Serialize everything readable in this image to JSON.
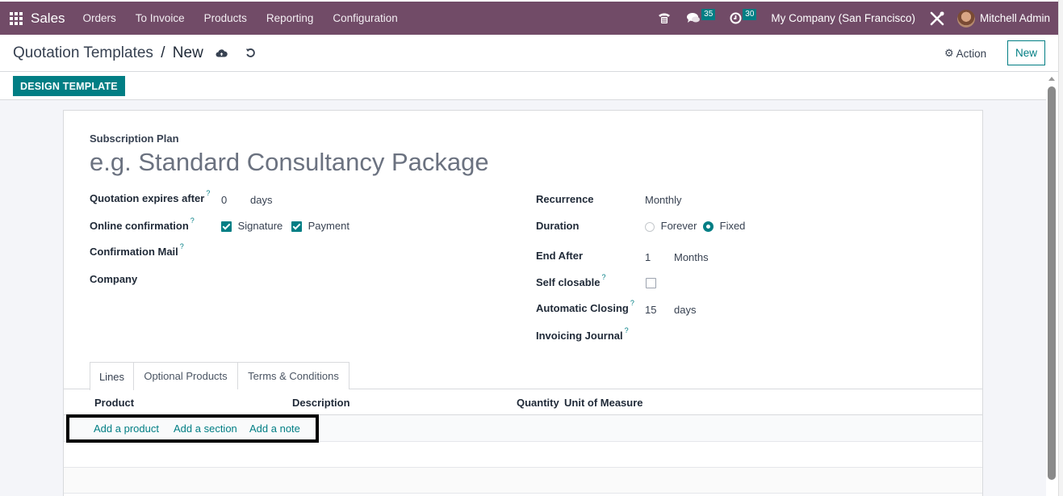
{
  "navbar": {
    "app_name": "Sales",
    "menu": [
      "Orders",
      "To Invoice",
      "Products",
      "Reporting",
      "Configuration"
    ],
    "icons": {
      "apps": "apps-grid-icon",
      "phone": "phone-icon",
      "messages": "chat-icon",
      "activities": "clock-icon",
      "debug": "tools-icon"
    },
    "messages_count": "35",
    "activities_count": "30",
    "company": "My Company (San Francisco)",
    "user": "Mitchell Admin"
  },
  "control_panel": {
    "breadcrumb_parent": "Quotation Templates",
    "breadcrumb_separator": "/",
    "breadcrumb_current": "New",
    "action_label": "Action",
    "new_label": "New"
  },
  "statusbar": {
    "design_template_label": "DESIGN TEMPLATE"
  },
  "form": {
    "plan_label": "Subscription Plan",
    "plan_name_placeholder": "e.g. Standard Consultancy Package",
    "left": {
      "quotation_expires_label": "Quotation expires after",
      "quotation_expires_value": "0",
      "quotation_expires_unit": "days",
      "online_confirmation_label": "Online confirmation",
      "signature_label": "Signature",
      "signature_checked": true,
      "payment_label": "Payment",
      "payment_checked": true,
      "confirmation_mail_label": "Confirmation Mail",
      "company_label": "Company"
    },
    "right": {
      "recurrence_label": "Recurrence",
      "recurrence_value": "Monthly",
      "duration_label": "Duration",
      "duration_options": [
        "Forever",
        "Fixed"
      ],
      "duration_selected": "Fixed",
      "end_after_label": "End After",
      "end_after_value": "1",
      "end_after_unit": "Months",
      "self_closable_label": "Self closable",
      "self_closable_checked": false,
      "automatic_closing_label": "Automatic Closing",
      "automatic_closing_value": "15",
      "automatic_closing_unit": "days",
      "invoicing_journal_label": "Invoicing Journal"
    },
    "help_marker": "?"
  },
  "tabs": [
    {
      "label": "Lines",
      "active": true
    },
    {
      "label": "Optional Products",
      "active": false
    },
    {
      "label": "Terms & Conditions",
      "active": false
    }
  ],
  "lines": {
    "columns": [
      "Product",
      "Description",
      "Quantity",
      "Unit of Measure"
    ],
    "add_product": "Add a product",
    "add_section": "Add a section",
    "add_note": "Add a note"
  }
}
